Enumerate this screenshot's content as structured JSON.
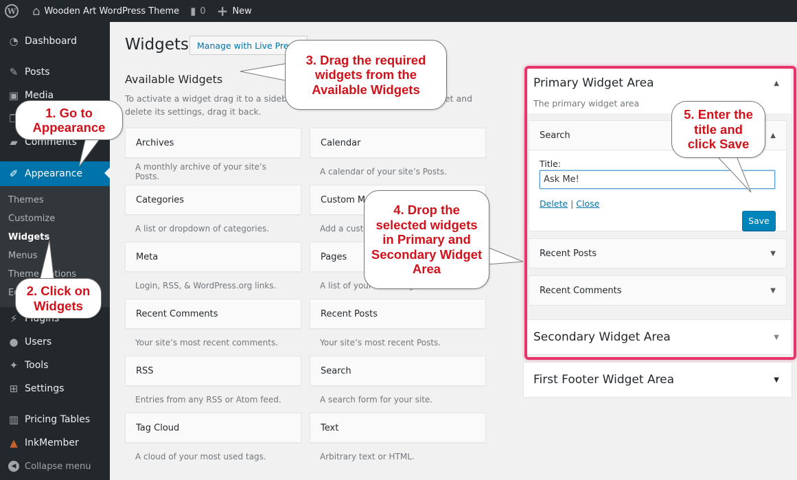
{
  "adminbar": {
    "site_name": "Wooden Art WordPress Theme",
    "comments_count": "0",
    "new_label": "New"
  },
  "sidebar": {
    "items": [
      {
        "label": "Dashboard",
        "icon": "dashboard-icon"
      },
      {
        "label": "Posts",
        "icon": "pin-icon"
      },
      {
        "label": "Media",
        "icon": "media-icon"
      },
      {
        "label": "Pages",
        "icon": "pages-icon"
      },
      {
        "label": "Comments",
        "icon": "comment-icon"
      },
      {
        "label": "Appearance",
        "icon": "paintbrush-icon"
      },
      {
        "label": "Plugins",
        "icon": "plugin-icon"
      },
      {
        "label": "Users",
        "icon": "users-icon"
      },
      {
        "label": "Tools",
        "icon": "wrench-icon"
      },
      {
        "label": "Settings",
        "icon": "settings-icon"
      },
      {
        "label": "Pricing Tables",
        "icon": "chart-bars-icon"
      },
      {
        "label": "InkMember",
        "icon": "inkmember-icon"
      }
    ],
    "submenu": [
      "Themes",
      "Customize",
      "Widgets",
      "Menus",
      "Theme Options",
      "Editor"
    ],
    "collapse_label": "Collapse menu"
  },
  "main": {
    "title": "Widgets",
    "live_preview_label": "Manage with Live Preview",
    "available_title": "Available Widgets",
    "available_desc": "To activate a widget drag it to a sidebar or click on it. To deactivate a widget and delete its settings, drag it back.",
    "widgets": [
      {
        "name": "Archives",
        "desc": "A monthly archive of your site’s Posts."
      },
      {
        "name": "Calendar",
        "desc": "A calendar of your site’s Posts."
      },
      {
        "name": "Categories",
        "desc": "A list or dropdown of categories."
      },
      {
        "name": "Custom Menu",
        "desc": "Add a custom menu to your sidebar."
      },
      {
        "name": "Meta",
        "desc": "Login, RSS, & WordPress.org links."
      },
      {
        "name": "Pages",
        "desc": "A list of your site’s Pages."
      },
      {
        "name": "Recent Comments",
        "desc": "Your site’s most recent comments."
      },
      {
        "name": "Recent Posts",
        "desc": "Your site’s most recent Posts."
      },
      {
        "name": "RSS",
        "desc": "Entries from any RSS or Atom feed."
      },
      {
        "name": "Search",
        "desc": "A search form for your site."
      },
      {
        "name": "Tag Cloud",
        "desc": "A cloud of your most used tags."
      },
      {
        "name": "Text",
        "desc": "Arbitrary text or HTML."
      }
    ]
  },
  "sidebars": {
    "primary": {
      "title": "Primary Widget Area",
      "desc": "The primary widget area",
      "search_widget": {
        "title": "Search",
        "field_label": "Title:",
        "field_value": "Ask Me!",
        "delete_label": "Delete",
        "separator": "|",
        "close_label": "Close",
        "save_label": "Save"
      },
      "other_widgets": [
        "Recent Posts",
        "Recent Comments"
      ]
    },
    "secondary": {
      "title": "Secondary Widget Area"
    },
    "footer": {
      "title": "First Footer Widget Area"
    }
  },
  "callouts": {
    "step1": "1. Go to Appearance",
    "step2": "2. Click on Widgets",
    "step3": "3. Drag the required widgets from the Available Widgets",
    "step4": "4. Drop the selected widgets in Primary and Secondary Widget Area",
    "step5": "5. Enter the title and click Save"
  },
  "colors": {
    "highlight": "#e6356a",
    "callout_text": "#d0121b",
    "accent": "#0073aa"
  }
}
